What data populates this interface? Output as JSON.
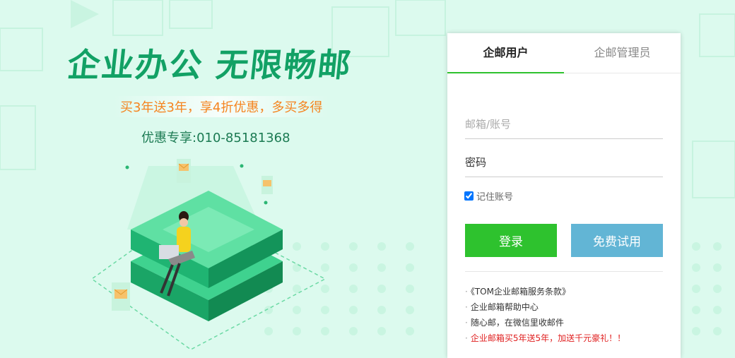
{
  "hero": {
    "headline": "企业办公 无限畅邮",
    "promo": "买3年送3年，享4折优惠，多买多得",
    "hotline": "优惠专享:010-85181368"
  },
  "login": {
    "tabs": [
      {
        "label": "企邮用户",
        "active": true
      },
      {
        "label": "企邮管理员",
        "active": false
      }
    ],
    "username_placeholder": "邮箱/账号",
    "password_placeholder": "密码",
    "remember_label": "记住账号",
    "remember_checked": true,
    "login_label": "登录",
    "trial_label": "免费试用",
    "links": [
      {
        "text": "《TOM企业邮箱服务条款》",
        "highlight": false
      },
      {
        "text": "企业邮箱帮助中心",
        "highlight": false
      },
      {
        "text": "随心邮，在微信里收邮件",
        "highlight": false
      },
      {
        "text": "企业邮箱买5年送5年，加送千元豪礼！！",
        "highlight": true
      }
    ],
    "link_bullet": "·"
  },
  "colors": {
    "background": "#dcfaee",
    "brand_green": "#12a165",
    "promo_orange": "#f5841f",
    "login_green": "#2ec22e",
    "trial_blue": "#62b5d5",
    "alert_red": "#e02020"
  }
}
